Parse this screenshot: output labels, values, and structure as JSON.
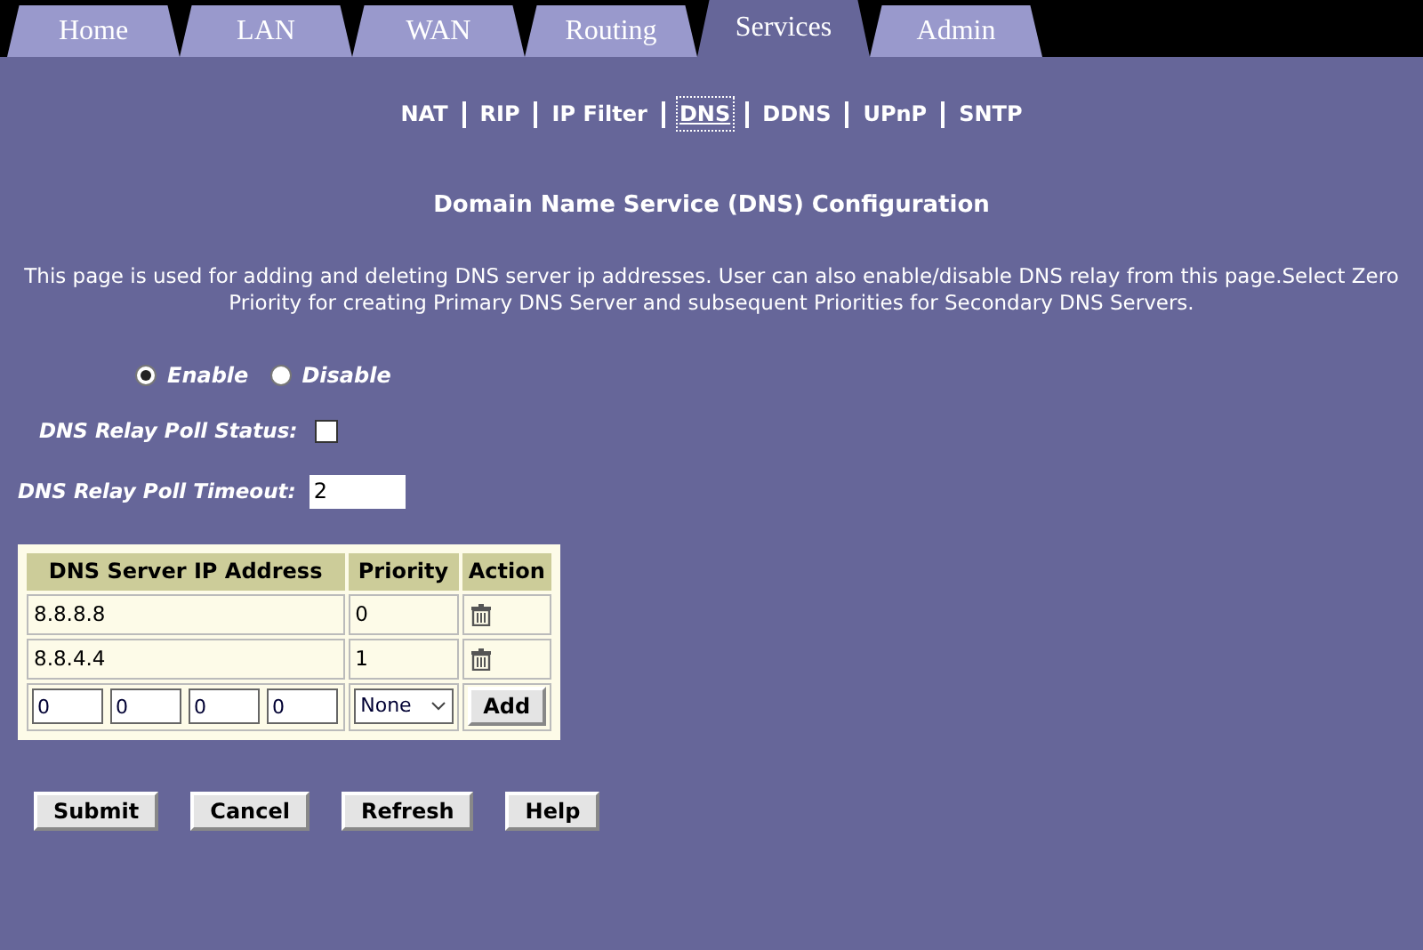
{
  "tabs": [
    {
      "label": "Home",
      "selected": false
    },
    {
      "label": "LAN",
      "selected": false
    },
    {
      "label": "WAN",
      "selected": false
    },
    {
      "label": "Routing",
      "selected": false
    },
    {
      "label": "Services",
      "selected": true
    },
    {
      "label": "Admin",
      "selected": false
    }
  ],
  "subnav": [
    {
      "label": "NAT",
      "selected": false
    },
    {
      "label": "RIP",
      "selected": false
    },
    {
      "label": "IP Filter",
      "selected": false
    },
    {
      "label": "DNS",
      "selected": true
    },
    {
      "label": "DDNS",
      "selected": false
    },
    {
      "label": "UPnP",
      "selected": false
    },
    {
      "label": "SNTP",
      "selected": false
    }
  ],
  "heading": "Domain Name Service (DNS) Configuration",
  "description": "This page is used for adding and deleting DNS server ip addresses. User can also enable/disable DNS relay from this page.Select Zero Priority for creating Primary DNS Server and subsequent Priorities for Secondary DNS Servers.",
  "relay_mode": [
    {
      "label": "Enable",
      "selected": true
    },
    {
      "label": "Disable",
      "selected": false
    }
  ],
  "poll_status": {
    "label": "DNS Relay Poll Status:",
    "checked": false
  },
  "poll_timeout": {
    "label": "DNS Relay Poll Timeout:",
    "value": "2"
  },
  "table": {
    "columns": [
      "DNS Server IP Address",
      "Priority",
      "Action"
    ],
    "rows": [
      {
        "address": "8.8.8.8",
        "priority": "0"
      },
      {
        "address": "8.8.4.4",
        "priority": "1"
      }
    ],
    "new_entry": {
      "octets": [
        "0",
        "0",
        "0",
        "0"
      ],
      "priority": "None",
      "button": "Add"
    }
  },
  "buttons": [
    "Submit",
    "Cancel",
    "Refresh",
    "Help"
  ]
}
